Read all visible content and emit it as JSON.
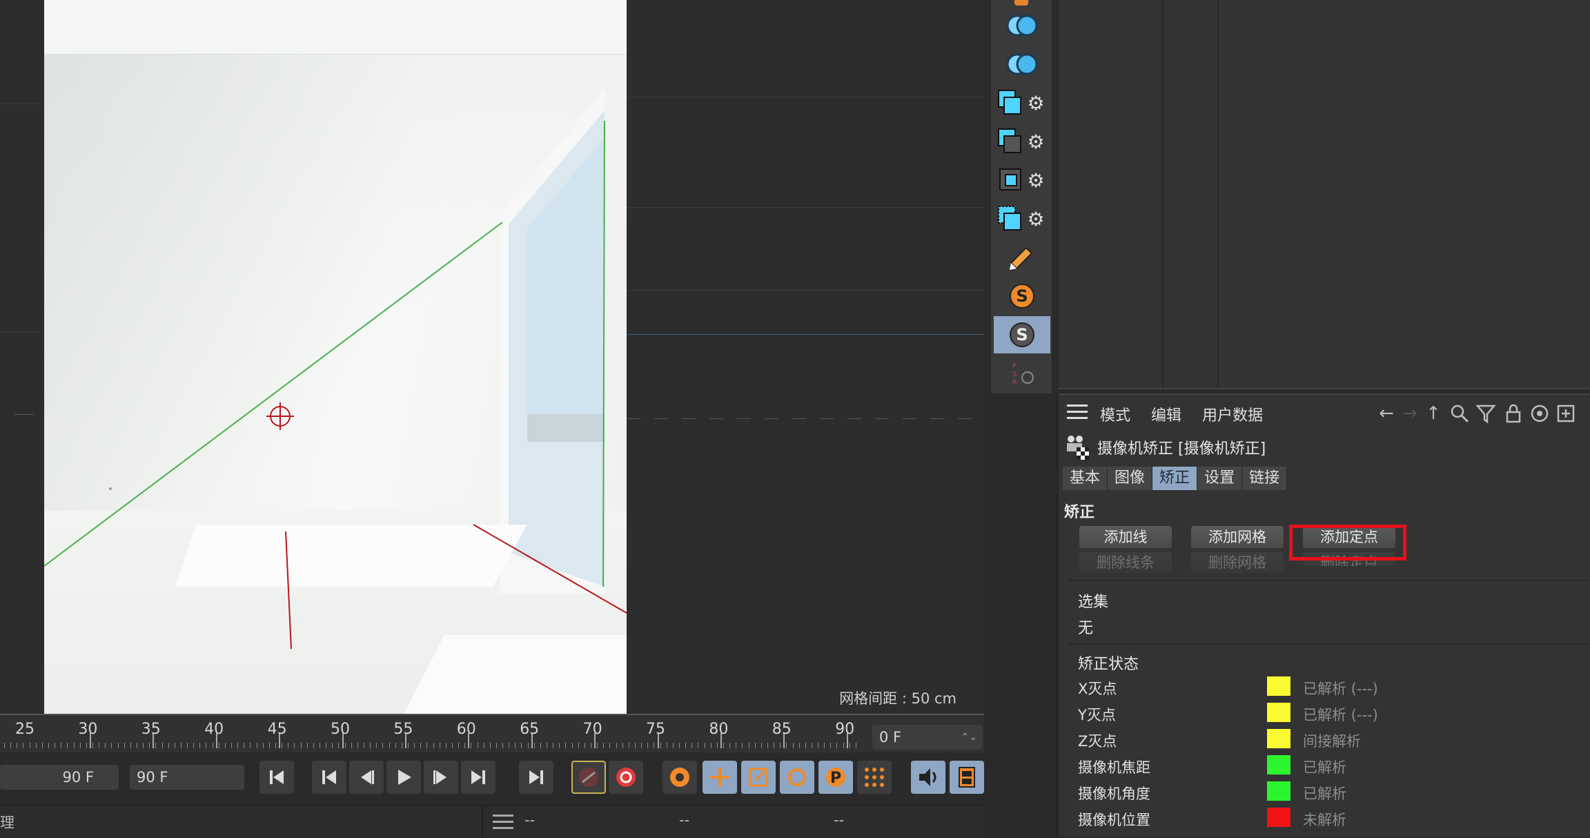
{
  "viewport": {
    "grid_spacing_label": "网格间距 : 50 cm"
  },
  "toolbar": {
    "icons": [
      "boolean-icon",
      "boolean-icon",
      "cloner-icon",
      "fracture-icon",
      "subdivision-icon",
      "extrude-icon",
      "sketch-icon",
      "spline-wrap-icon",
      "camera-calibrator-icon",
      "psr-icon"
    ],
    "active_index": 8
  },
  "attr": {
    "menu": {
      "mode": "模式",
      "edit": "编辑",
      "user_data": "用户数据"
    },
    "object_title": "摄像机矫正 [摄像机矫正]",
    "tabs": [
      "基本",
      "图像",
      "矫正",
      "设置",
      "链接"
    ],
    "active_tab": "矫正",
    "section_calibrate": "矫正",
    "buttons": {
      "add_line": "添加线",
      "add_grid": "添加网格",
      "add_point": "添加定点",
      "delete_line": "删除线条",
      "delete_grid": "删除网格",
      "delete_point": "删除定点"
    },
    "selection_label": "选集",
    "selection_value": "无",
    "status_label": "矫正状态",
    "status": [
      {
        "label": "X灭点",
        "color": "#fafa32",
        "value": "已解析 (---)"
      },
      {
        "label": "Y灭点",
        "color": "#fafa32",
        "value": "已解析 (---)"
      },
      {
        "label": "Z灭点",
        "color": "#fafa32",
        "value": "间接解析"
      },
      {
        "label": "摄像机焦距",
        "color": "#2df52d",
        "value": "已解析"
      },
      {
        "label": "摄像机角度",
        "color": "#2df52d",
        "value": "已解析"
      },
      {
        "label": "摄像机位置",
        "color": "#f01414",
        "value": "未解析"
      }
    ]
  },
  "timeline": {
    "ticks": [
      "25",
      "30",
      "35",
      "40",
      "45",
      "50",
      "55",
      "60",
      "65",
      "70",
      "75",
      "80",
      "85",
      "90"
    ],
    "current_frame": "0 F"
  },
  "transport": {
    "end_frame_left": "90 F",
    "end_frame_right": "90 F"
  },
  "bottombar": {
    "left_text": "理",
    "dashes": [
      "--",
      "--",
      "--"
    ]
  }
}
